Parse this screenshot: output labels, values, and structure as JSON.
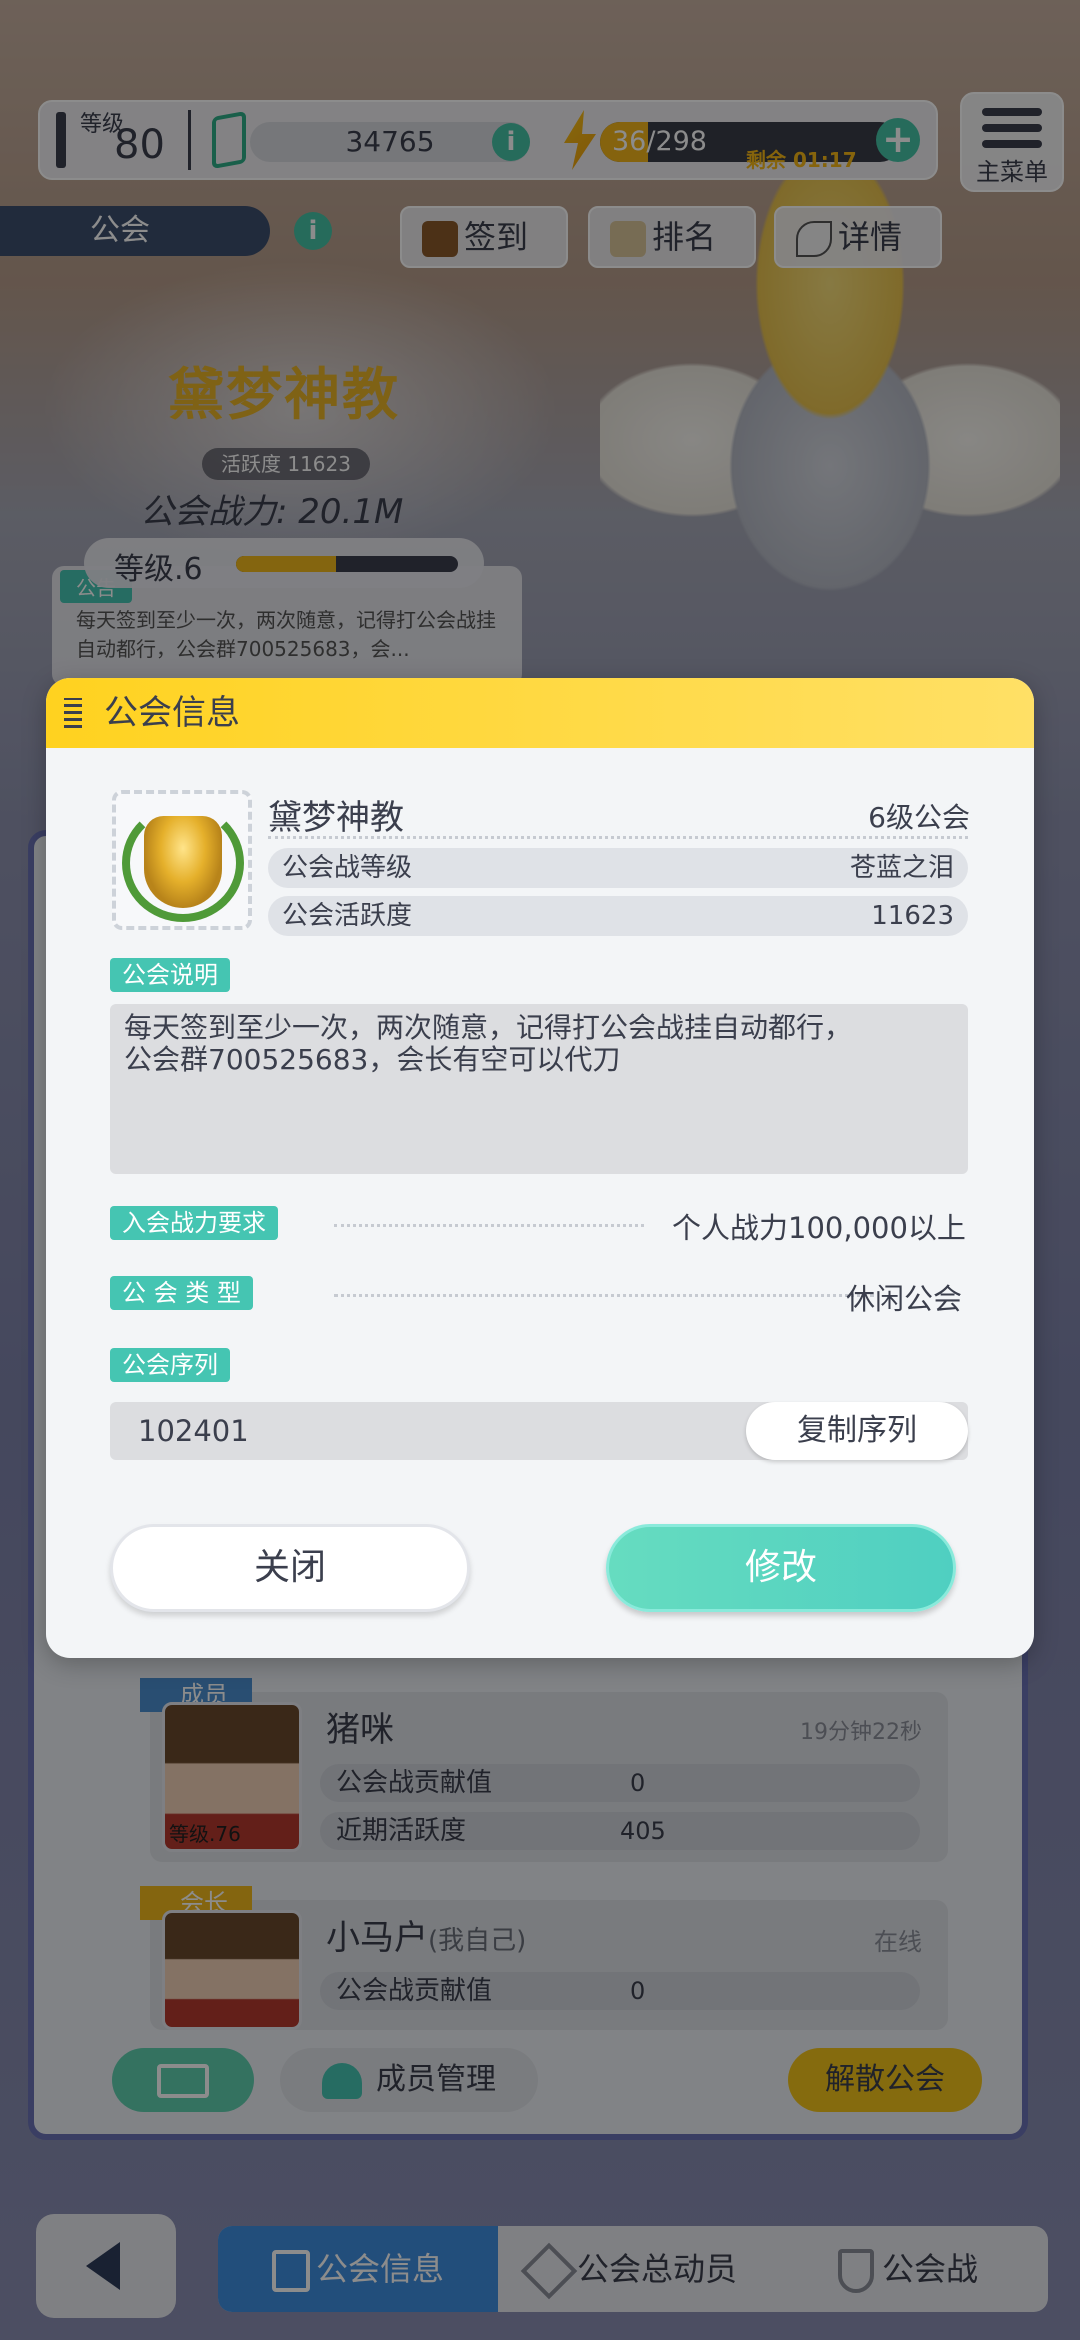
{
  "hud": {
    "level_label": "等级",
    "level_value": "80",
    "currency_value": "34765",
    "stamina_value": "36/298",
    "timer_text": "剩余 01:17",
    "menu_label": "主菜单"
  },
  "guild_header": {
    "tab_label": "公会",
    "buttons": [
      "签到",
      "排名",
      "详情"
    ],
    "guild_name": "黛梦神教",
    "activity": "活跃度 11623",
    "power": "公会战力:  20.1M",
    "level": "等级.6",
    "level_progress": 0.45,
    "notice_label": "公告",
    "notice_text": "每天签到至少一次，两次随意，记得打公会战挂自动都行，公会群700525683，会..."
  },
  "dialog": {
    "title": "公会信息",
    "guild_name": "黛梦神教",
    "guild_level": "6级公会",
    "rows": [
      {
        "label": "公会战等级",
        "value": "苍蓝之泪"
      },
      {
        "label": "公会活跃度",
        "value": "11623"
      }
    ],
    "desc_label": "公会说明",
    "desc_text": "每天签到至少一次，两次随意，记得打公会战挂自动都行，\n公会群700525683，会长有空可以代刀",
    "power_req_label": "入会战力要求",
    "power_req_value": "个人战力100,000以上",
    "type_label": "公 会 类 型",
    "type_value": "休闲公会",
    "serial_label": "公会序列",
    "serial_value": "102401",
    "copy_label": "复制序列",
    "close_label": "关闭",
    "edit_label": "修改"
  },
  "members": [
    {
      "role": "成员",
      "name": "猪咪",
      "status": "19分钟22秒",
      "avatar_level": "等级.76",
      "contrib_label": "公会战贡献值",
      "contrib": "0",
      "activity_label": "近期活跃度",
      "activity": "405"
    },
    {
      "role": "会长",
      "name": "小马户",
      "self_tag": "(我自己)",
      "status": "在线",
      "contrib_label": "公会战贡献值",
      "contrib": "0"
    }
  ],
  "member_actions": {
    "manage_label": "成员管理",
    "disband_label": "解散公会"
  },
  "nav": {
    "tabs": [
      "公会信息",
      "公会总动员",
      "公会战"
    ]
  },
  "colors": {
    "accent_teal": "#45c5b2",
    "header_yellow": "#ffd21f",
    "panel_border": "#6a72b4"
  }
}
